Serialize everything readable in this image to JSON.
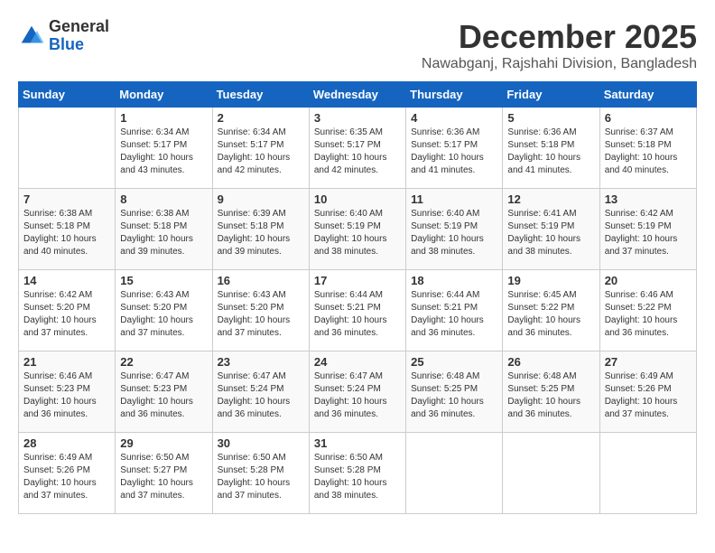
{
  "logo": {
    "general": "General",
    "blue": "Blue"
  },
  "header": {
    "month": "December 2025",
    "subtitle": "Nawabganj, Rajshahi Division, Bangladesh"
  },
  "days_header": [
    "Sunday",
    "Monday",
    "Tuesday",
    "Wednesday",
    "Thursday",
    "Friday",
    "Saturday"
  ],
  "weeks": [
    [
      {
        "day": "",
        "info": ""
      },
      {
        "day": "1",
        "info": "Sunrise: 6:34 AM\nSunset: 5:17 PM\nDaylight: 10 hours\nand 43 minutes."
      },
      {
        "day": "2",
        "info": "Sunrise: 6:34 AM\nSunset: 5:17 PM\nDaylight: 10 hours\nand 42 minutes."
      },
      {
        "day": "3",
        "info": "Sunrise: 6:35 AM\nSunset: 5:17 PM\nDaylight: 10 hours\nand 42 minutes."
      },
      {
        "day": "4",
        "info": "Sunrise: 6:36 AM\nSunset: 5:17 PM\nDaylight: 10 hours\nand 41 minutes."
      },
      {
        "day": "5",
        "info": "Sunrise: 6:36 AM\nSunset: 5:18 PM\nDaylight: 10 hours\nand 41 minutes."
      },
      {
        "day": "6",
        "info": "Sunrise: 6:37 AM\nSunset: 5:18 PM\nDaylight: 10 hours\nand 40 minutes."
      }
    ],
    [
      {
        "day": "7",
        "info": "Sunrise: 6:38 AM\nSunset: 5:18 PM\nDaylight: 10 hours\nand 40 minutes."
      },
      {
        "day": "8",
        "info": "Sunrise: 6:38 AM\nSunset: 5:18 PM\nDaylight: 10 hours\nand 39 minutes."
      },
      {
        "day": "9",
        "info": "Sunrise: 6:39 AM\nSunset: 5:18 PM\nDaylight: 10 hours\nand 39 minutes."
      },
      {
        "day": "10",
        "info": "Sunrise: 6:40 AM\nSunset: 5:19 PM\nDaylight: 10 hours\nand 38 minutes."
      },
      {
        "day": "11",
        "info": "Sunrise: 6:40 AM\nSunset: 5:19 PM\nDaylight: 10 hours\nand 38 minutes."
      },
      {
        "day": "12",
        "info": "Sunrise: 6:41 AM\nSunset: 5:19 PM\nDaylight: 10 hours\nand 38 minutes."
      },
      {
        "day": "13",
        "info": "Sunrise: 6:42 AM\nSunset: 5:19 PM\nDaylight: 10 hours\nand 37 minutes."
      }
    ],
    [
      {
        "day": "14",
        "info": "Sunrise: 6:42 AM\nSunset: 5:20 PM\nDaylight: 10 hours\nand 37 minutes."
      },
      {
        "day": "15",
        "info": "Sunrise: 6:43 AM\nSunset: 5:20 PM\nDaylight: 10 hours\nand 37 minutes."
      },
      {
        "day": "16",
        "info": "Sunrise: 6:43 AM\nSunset: 5:20 PM\nDaylight: 10 hours\nand 37 minutes."
      },
      {
        "day": "17",
        "info": "Sunrise: 6:44 AM\nSunset: 5:21 PM\nDaylight: 10 hours\nand 36 minutes."
      },
      {
        "day": "18",
        "info": "Sunrise: 6:44 AM\nSunset: 5:21 PM\nDaylight: 10 hours\nand 36 minutes."
      },
      {
        "day": "19",
        "info": "Sunrise: 6:45 AM\nSunset: 5:22 PM\nDaylight: 10 hours\nand 36 minutes."
      },
      {
        "day": "20",
        "info": "Sunrise: 6:46 AM\nSunset: 5:22 PM\nDaylight: 10 hours\nand 36 minutes."
      }
    ],
    [
      {
        "day": "21",
        "info": "Sunrise: 6:46 AM\nSunset: 5:23 PM\nDaylight: 10 hours\nand 36 minutes."
      },
      {
        "day": "22",
        "info": "Sunrise: 6:47 AM\nSunset: 5:23 PM\nDaylight: 10 hours\nand 36 minutes."
      },
      {
        "day": "23",
        "info": "Sunrise: 6:47 AM\nSunset: 5:24 PM\nDaylight: 10 hours\nand 36 minutes."
      },
      {
        "day": "24",
        "info": "Sunrise: 6:47 AM\nSunset: 5:24 PM\nDaylight: 10 hours\nand 36 minutes."
      },
      {
        "day": "25",
        "info": "Sunrise: 6:48 AM\nSunset: 5:25 PM\nDaylight: 10 hours\nand 36 minutes."
      },
      {
        "day": "26",
        "info": "Sunrise: 6:48 AM\nSunset: 5:25 PM\nDaylight: 10 hours\nand 36 minutes."
      },
      {
        "day": "27",
        "info": "Sunrise: 6:49 AM\nSunset: 5:26 PM\nDaylight: 10 hours\nand 37 minutes."
      }
    ],
    [
      {
        "day": "28",
        "info": "Sunrise: 6:49 AM\nSunset: 5:26 PM\nDaylight: 10 hours\nand 37 minutes."
      },
      {
        "day": "29",
        "info": "Sunrise: 6:50 AM\nSunset: 5:27 PM\nDaylight: 10 hours\nand 37 minutes."
      },
      {
        "day": "30",
        "info": "Sunrise: 6:50 AM\nSunset: 5:28 PM\nDaylight: 10 hours\nand 37 minutes."
      },
      {
        "day": "31",
        "info": "Sunrise: 6:50 AM\nSunset: 5:28 PM\nDaylight: 10 hours\nand 38 minutes."
      },
      {
        "day": "",
        "info": ""
      },
      {
        "day": "",
        "info": ""
      },
      {
        "day": "",
        "info": ""
      }
    ]
  ]
}
